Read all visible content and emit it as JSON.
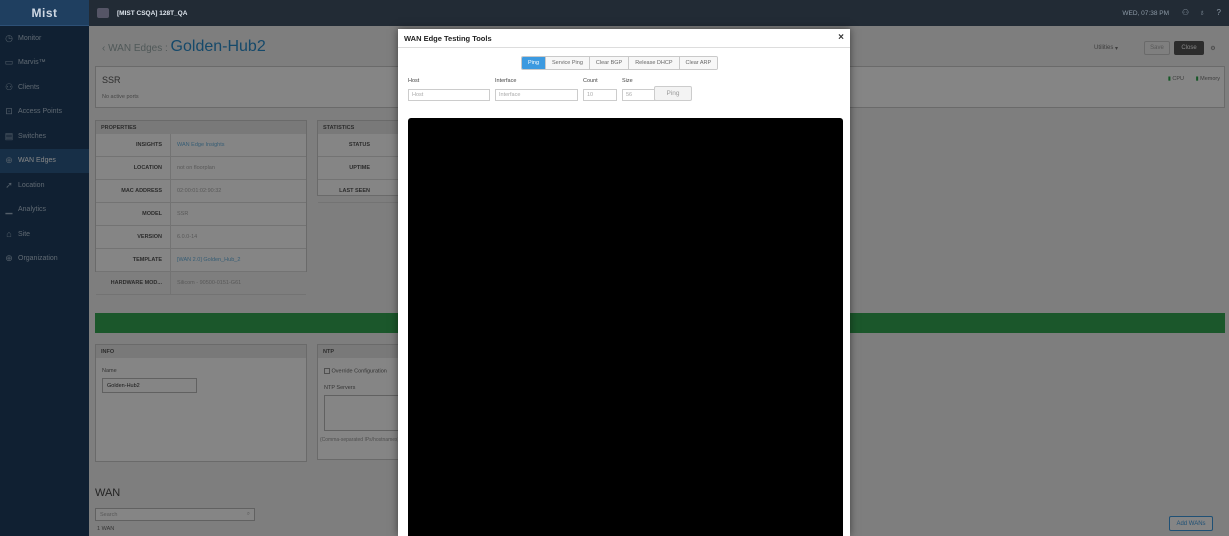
{
  "sidebar": {
    "brand": "Mist",
    "items": [
      {
        "label": "Monitor",
        "icon": "monitor-icon",
        "glyph": "◷"
      },
      {
        "label": "Marvis™",
        "icon": "marvis-icon",
        "glyph": "▭"
      },
      {
        "label": "Clients",
        "icon": "clients-icon",
        "glyph": "⚇"
      },
      {
        "label": "Access Points",
        "icon": "access-points-icon",
        "glyph": "⊡"
      },
      {
        "label": "Switches",
        "icon": "switches-icon",
        "glyph": "▤"
      },
      {
        "label": "WAN Edges",
        "icon": "wan-edges-icon",
        "glyph": "⊕",
        "active": true
      },
      {
        "label": "Location",
        "icon": "location-icon",
        "glyph": "➚"
      },
      {
        "label": "Analytics",
        "icon": "analytics-icon",
        "glyph": "▁"
      },
      {
        "label": "Site",
        "icon": "site-icon",
        "glyph": "⌂"
      },
      {
        "label": "Organization",
        "icon": "organization-icon",
        "glyph": "⊕"
      }
    ]
  },
  "topbar": {
    "org_name": "[MIST CSQA] 128T_QA",
    "clock": "WED, 07:38 PM"
  },
  "page": {
    "breadcrumb": "WAN Edges :",
    "title": "Golden-Hub2",
    "utilities": "Utilities",
    "save": "Save",
    "close": "Close",
    "ssr": "SSR",
    "no_ports": "No active ports",
    "cpu": "CPU",
    "memory": "Memory"
  },
  "properties": {
    "heading": "PROPERTIES",
    "rows": [
      {
        "k": "INSIGHTS",
        "v": "WAN Edge Insights",
        "link": true
      },
      {
        "k": "LOCATION",
        "v": "not on floorplan",
        "link": false
      },
      {
        "k": "MAC ADDRESS",
        "v": "02:00:01:02:90:32",
        "link": false
      },
      {
        "k": "MODEL",
        "v": "SSR",
        "link": false
      },
      {
        "k": "VERSION",
        "v": "6.0.0-14",
        "link": false
      },
      {
        "k": "TEMPLATE",
        "v": "[WAN 2.0] Golden_Hub_2",
        "link": true
      },
      {
        "k": "HARDWARE MOD...",
        "v": "Silicom - 90500-0151-G61",
        "link": false
      }
    ]
  },
  "statistics": {
    "heading": "STATISTICS",
    "rows": [
      "STATUS",
      "UPTIME",
      "LAST SEEN"
    ]
  },
  "info": {
    "heading": "INFO",
    "name_label": "Name",
    "name_value": "Golden-Hub2"
  },
  "ntp": {
    "heading": "NTP",
    "override": "Override Configuration",
    "servers_label": "NTP Servers",
    "hint": "(Comma-separated IPs/hostnames)"
  },
  "wan": {
    "heading": "WAN",
    "search_placeholder": "Search",
    "count": "1 WAN",
    "add": "Add WANs"
  },
  "modal": {
    "title": "WAN Edge Testing Tools",
    "close": "×",
    "tabs": [
      {
        "label": "Ping",
        "active": true
      },
      {
        "label": "Service Ping",
        "active": false
      },
      {
        "label": "Clear BGP",
        "active": false
      },
      {
        "label": "Release DHCP",
        "active": false
      },
      {
        "label": "Clear ARP",
        "active": false
      }
    ],
    "host_label": "Host",
    "host_placeholder": "Host",
    "interface_label": "Interface",
    "interface_placeholder": "Interface",
    "count_label": "Count",
    "count_value": "10",
    "size_label": "Size",
    "size_value": "56",
    "ping_button": "Ping"
  }
}
